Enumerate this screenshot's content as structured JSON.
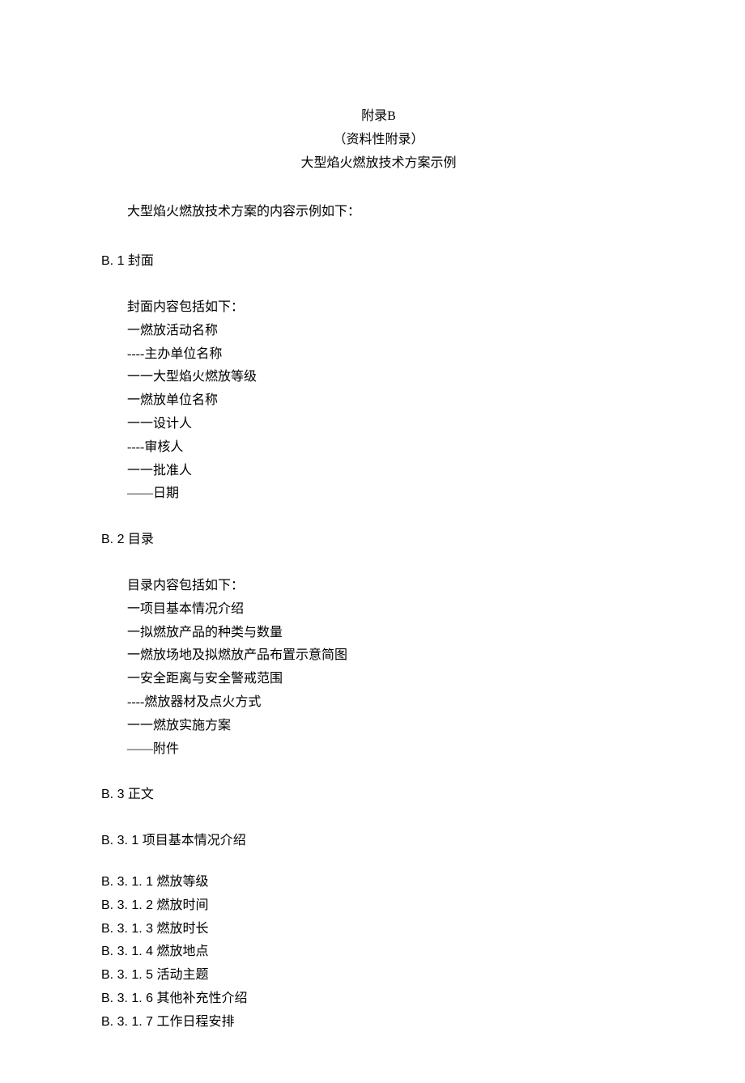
{
  "header": {
    "appendix": "附录B",
    "subtitle": "（资料性附录）",
    "title": "大型焰火燃放技术方案示例"
  },
  "intro": "大型焰火燃放技术方案的内容示例如下：",
  "sections": {
    "b1": {
      "num": "B. 1 ",
      "title": "封面",
      "lead": "封面内容包括如下：",
      "items": [
        "  一燃放活动名称",
        "----主办单位名称",
        "一一大型焰火燃放等级",
        "  一燃放单位名称",
        "一一设计人",
        "----审核人",
        "一一批准人",
        "——日期"
      ]
    },
    "b2": {
      "num": "B. 2 ",
      "title": "目录",
      "lead": "目录内容包括如下：",
      "items": [
        "  一项目基本情况介绍",
        "  一拟燃放产品的种类与数量",
        "  一燃放场地及拟燃放产品布置示意简图",
        "  一安全距离与安全警戒范围",
        "----燃放器材及点火方式",
        "一一燃放实施方案",
        "——附件"
      ]
    },
    "b3": {
      "num": "B. 3 ",
      "title": "正文",
      "sub": {
        "num": "B. 3. 1 ",
        "title": "项目基本情况介绍",
        "items": [
          {
            "num": "B. 3. 1. 1 ",
            "title": "燃放等级"
          },
          {
            "num": "B. 3. 1. 2 ",
            "title": "燃放时间"
          },
          {
            "num": "B. 3. 1. 3 ",
            "title": "燃放时长"
          },
          {
            "num": "B. 3. 1. 4 ",
            "title": "燃放地点"
          },
          {
            "num": "B. 3. 1. 5 ",
            "title": "活动主题"
          },
          {
            "num": "B. 3. 1. 6 ",
            "title": "其他补充性介绍"
          },
          {
            "num": "B. 3. 1. 7 ",
            "title": "工作日程安排"
          }
        ]
      }
    }
  }
}
